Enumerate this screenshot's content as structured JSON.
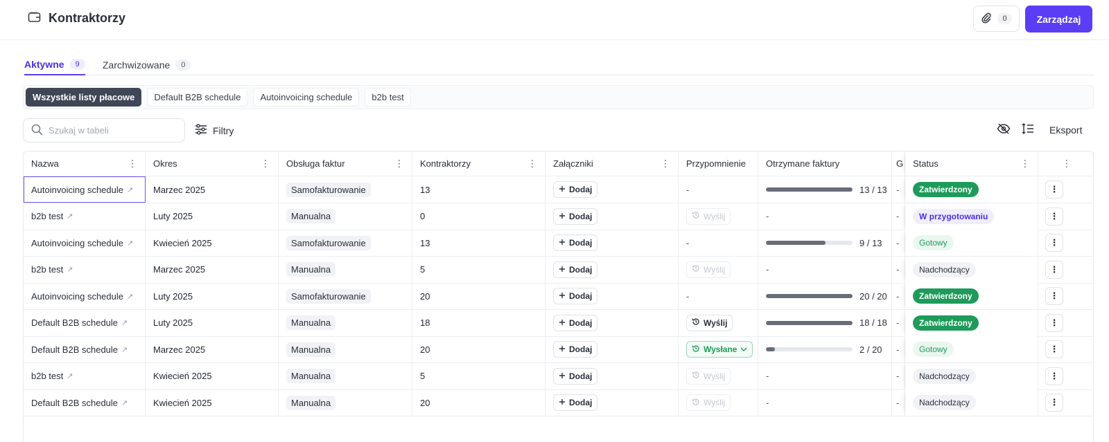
{
  "header": {
    "title": "Kontraktorzy",
    "attachments_count": "0",
    "manage_label": "Zarządzaj"
  },
  "tabs": [
    {
      "label": "Aktywne",
      "count": "9"
    },
    {
      "label": "Zarchwizowane",
      "count": "0"
    }
  ],
  "schedules": [
    "Wszystkie listy płacowe",
    "Default B2B schedule",
    "Autoinvoicing schedule",
    "b2b test"
  ],
  "toolbar": {
    "search_placeholder": "Szukaj w tabeli",
    "filters_label": "Filtry",
    "export_label": "Eksport"
  },
  "columns": [
    "Nazwa",
    "Okres",
    "Obsługa faktur",
    "Kontraktorzy",
    "Załączniki",
    "Przypomnienie",
    "Otrzymane faktury",
    "G",
    "Status"
  ],
  "add_label": "Dodaj",
  "rows": [
    {
      "name": "Autoinvoicing schedule",
      "period": "Marzec 2025",
      "invoicing": "Samofakturowanie",
      "contractors": "13",
      "reminder": "-",
      "reminder_type": "none",
      "received": "13 / 13",
      "received_ratio": 1.0,
      "g": "-",
      "status": "Zatwierdzony",
      "status_type": "approved"
    },
    {
      "name": "b2b test",
      "period": "Luty 2025",
      "invoicing": "Manualna",
      "contractors": "0",
      "reminder": "Wyślij",
      "reminder_type": "disabled",
      "received": "-",
      "received_ratio": null,
      "g": "-",
      "status": "W przygotowaniu",
      "status_type": "prep"
    },
    {
      "name": "Autoinvoicing schedule",
      "period": "Kwiecień 2025",
      "invoicing": "Samofakturowanie",
      "contractors": "13",
      "reminder": "-",
      "reminder_type": "none",
      "received": "9 / 13",
      "received_ratio": 0.69,
      "g": "-",
      "status": "Gotowy",
      "status_type": "ready"
    },
    {
      "name": "b2b test",
      "period": "Marzec 2025",
      "invoicing": "Manualna",
      "contractors": "5",
      "reminder": "Wyślij",
      "reminder_type": "disabled",
      "received": "-",
      "received_ratio": null,
      "g": "-",
      "status": "Nadchodzący",
      "status_type": "upcoming"
    },
    {
      "name": "Autoinvoicing schedule",
      "period": "Luty 2025",
      "invoicing": "Samofakturowanie",
      "contractors": "20",
      "reminder": "-",
      "reminder_type": "none",
      "received": "20 / 20",
      "received_ratio": 1.0,
      "g": "-",
      "status": "Zatwierdzony",
      "status_type": "approved"
    },
    {
      "name": "Default B2B schedule",
      "period": "Luty 2025",
      "invoicing": "Manualna",
      "contractors": "18",
      "reminder": "Wyślij",
      "reminder_type": "active",
      "received": "18 / 18",
      "received_ratio": 1.0,
      "g": "-",
      "status": "Zatwierdzony",
      "status_type": "approved"
    },
    {
      "name": "Default B2B schedule",
      "period": "Marzec 2025",
      "invoicing": "Manualna",
      "contractors": "20",
      "reminder": "Wysłane",
      "reminder_type": "sent",
      "received": "2 / 20",
      "received_ratio": 0.1,
      "g": "-",
      "status": "Gotowy",
      "status_type": "ready"
    },
    {
      "name": "b2b test",
      "period": "Kwiecień 2025",
      "invoicing": "Manualna",
      "contractors": "5",
      "reminder": "Wyślij",
      "reminder_type": "disabled",
      "received": "-",
      "received_ratio": null,
      "g": "-",
      "status": "Nadchodzący",
      "status_type": "upcoming"
    },
    {
      "name": "Default B2B schedule",
      "period": "Kwiecień 2025",
      "invoicing": "Manualna",
      "contractors": "20",
      "reminder": "Wyślij",
      "reminder_type": "disabled",
      "received": "-",
      "received_ratio": null,
      "g": "-",
      "status": "Nadchodzący",
      "status_type": "upcoming"
    }
  ]
}
